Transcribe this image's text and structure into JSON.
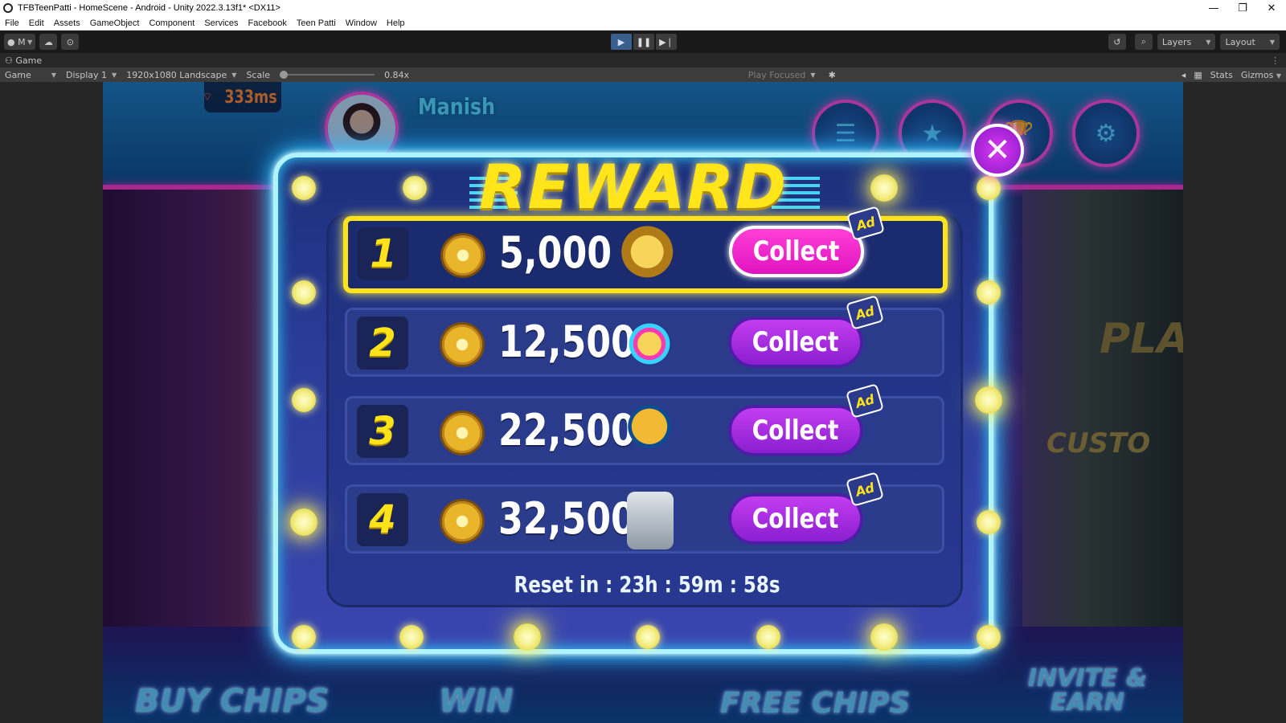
{
  "window": {
    "title": "TFBTeenPatti - HomeScene - Android - Unity 2022.3.13f1* <DX11>",
    "controls": [
      "—",
      "❐",
      "✕"
    ]
  },
  "menu": [
    "File",
    "Edit",
    "Assets",
    "GameObject",
    "Component",
    "Services",
    "Facebook",
    "Teen Patti",
    "Window",
    "Help"
  ],
  "toolbar": {
    "account_label": "M",
    "layers_label": "Layers",
    "layout_label": "Layout"
  },
  "tab": {
    "label": "Game"
  },
  "gamebar": {
    "view_mode": "Game",
    "display": "Display 1",
    "resolution": "1920x1080 Landscape",
    "scale_label": "Scale",
    "scale_value": "0.84x",
    "play_mode": "Play Focused",
    "stats_label": "Stats",
    "gizmos_label": "Gizmos"
  },
  "hud": {
    "ping": "333ms",
    "username": "Manish"
  },
  "reward": {
    "title": "REWARD",
    "items": [
      {
        "rank": "1",
        "amount": "5,000",
        "button": "Collect",
        "badge": "Ad",
        "icon": "coin-stack-icon"
      },
      {
        "rank": "2",
        "amount": "12,500",
        "button": "Collect",
        "badge": "Ad",
        "icon": "roulette-icon"
      },
      {
        "rank": "3",
        "amount": "22,500",
        "button": "Collect",
        "badge": "Ad",
        "icon": "coin-bag-icon"
      },
      {
        "rank": "4",
        "amount": "32,500",
        "button": "Collect",
        "badge": "Ad",
        "icon": "safe-icon"
      }
    ],
    "reset_text": "Reset in : 23h : 59m : 58s"
  },
  "bottom": {
    "buy_chips": "BUY CHIPS",
    "win": "WIN",
    "free_chips": "FREE CHIPS",
    "invite_earn": "INVITE & EARN"
  },
  "background_signs": {
    "play": "PLA",
    "custom": "CUSTO"
  },
  "colors": {
    "accent_yellow": "#ffe31a",
    "neon_cyan": "#2fd8ff",
    "button_purple": "#8a1ed0",
    "button_pink": "#ff3fd6"
  }
}
